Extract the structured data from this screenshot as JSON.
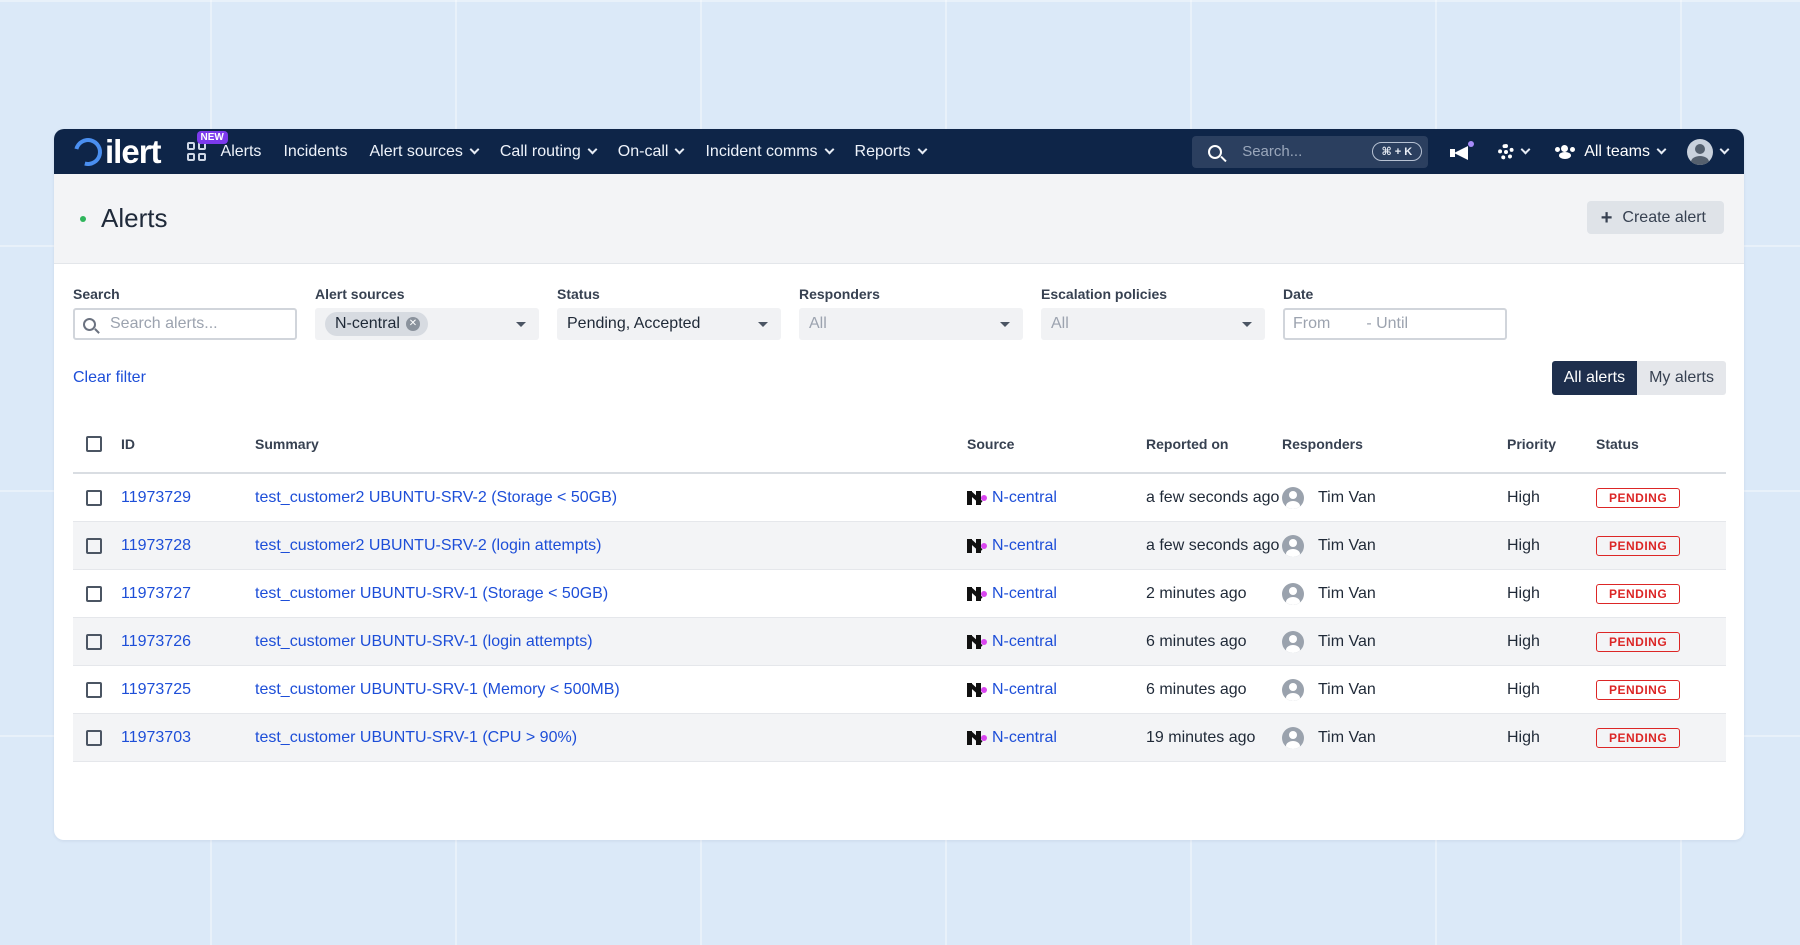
{
  "nav": {
    "logo": "ilert",
    "new_badge": "NEW",
    "items": [
      {
        "label": "Alerts",
        "dropdown": false
      },
      {
        "label": "Incidents",
        "dropdown": false
      },
      {
        "label": "Alert sources",
        "dropdown": true
      },
      {
        "label": "Call routing",
        "dropdown": true
      },
      {
        "label": "On-call",
        "dropdown": true
      },
      {
        "label": "Incident comms",
        "dropdown": true
      },
      {
        "label": "Reports",
        "dropdown": true
      }
    ],
    "search_placeholder": "Search...",
    "search_shortcut": "⌘ + K",
    "teams_label": "All teams"
  },
  "header": {
    "title": "Alerts",
    "create_label": "Create alert"
  },
  "filters": {
    "search": {
      "label": "Search",
      "placeholder": "Search alerts..."
    },
    "alert_sources": {
      "label": "Alert sources",
      "chip": "N-central"
    },
    "status": {
      "label": "Status",
      "value": "Pending, Accepted"
    },
    "responders": {
      "label": "Responders",
      "value": "All"
    },
    "escalation": {
      "label": "Escalation policies",
      "value": "All"
    },
    "date": {
      "label": "Date",
      "from": "From",
      "until": "- Until"
    }
  },
  "actions": {
    "clear": "Clear filter",
    "all_alerts": "All alerts",
    "my_alerts": "My alerts"
  },
  "table": {
    "headers": {
      "id": "ID",
      "summary": "Summary",
      "source": "Source",
      "reported": "Reported on",
      "responders": "Responders",
      "priority": "Priority",
      "status": "Status"
    },
    "rows": [
      {
        "id": "11973729",
        "summary": "test_customer2 UBUNTU-SRV-2 (Storage < 50GB)",
        "source": "N-central",
        "reported": "a few seconds ago",
        "responder": "Tim Van",
        "priority": "High",
        "status": "PENDING"
      },
      {
        "id": "11973728",
        "summary": "test_customer2 UBUNTU-SRV-2 (login attempts)",
        "source": "N-central",
        "reported": "a few seconds ago",
        "responder": "Tim Van",
        "priority": "High",
        "status": "PENDING"
      },
      {
        "id": "11973727",
        "summary": "test_customer UBUNTU-SRV-1 (Storage < 50GB)",
        "source": "N-central",
        "reported": "2 minutes ago",
        "responder": "Tim Van",
        "priority": "High",
        "status": "PENDING"
      },
      {
        "id": "11973726",
        "summary": "test_customer UBUNTU-SRV-1 (login attempts)",
        "source": "N-central",
        "reported": "6 minutes ago",
        "responder": "Tim Van",
        "priority": "High",
        "status": "PENDING"
      },
      {
        "id": "11973725",
        "summary": "test_customer UBUNTU-SRV-1 (Memory < 500MB)",
        "source": "N-central",
        "reported": "6 minutes ago",
        "responder": "Tim Van",
        "priority": "High",
        "status": "PENDING"
      },
      {
        "id": "11973703",
        "summary": "test_customer UBUNTU-SRV-1 (CPU > 90%)",
        "source": "N-central",
        "reported": "19 minutes ago",
        "responder": "Tim Van",
        "priority": "High",
        "status": "PENDING"
      }
    ]
  }
}
